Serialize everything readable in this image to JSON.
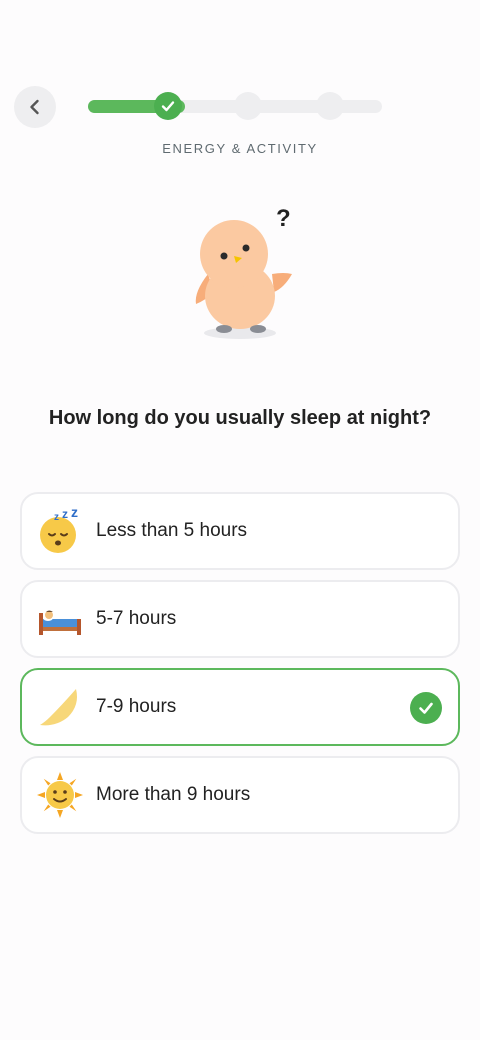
{
  "header": {
    "back_icon": "chevron-left-icon",
    "section_label": "ENERGY & ACTIVITY",
    "progress": {
      "steps": 4,
      "completed": 1,
      "fill_fraction": 0.33
    }
  },
  "question": "How long do you usually sleep at night?",
  "options": [
    {
      "label": "Less than 5 hours",
      "icon": "sleeping-face-icon",
      "selected": false
    },
    {
      "label": "5-7 hours",
      "icon": "person-in-bed-icon",
      "selected": false
    },
    {
      "label": "7-9 hours",
      "icon": "crescent-moon-icon",
      "selected": true
    },
    {
      "label": "More than 9 hours",
      "icon": "sun-with-face-icon",
      "selected": false
    }
  ],
  "colors": {
    "accent_green": "#4caf50",
    "option_border": "#ececef",
    "mascot_body": "#fbc9a1"
  }
}
